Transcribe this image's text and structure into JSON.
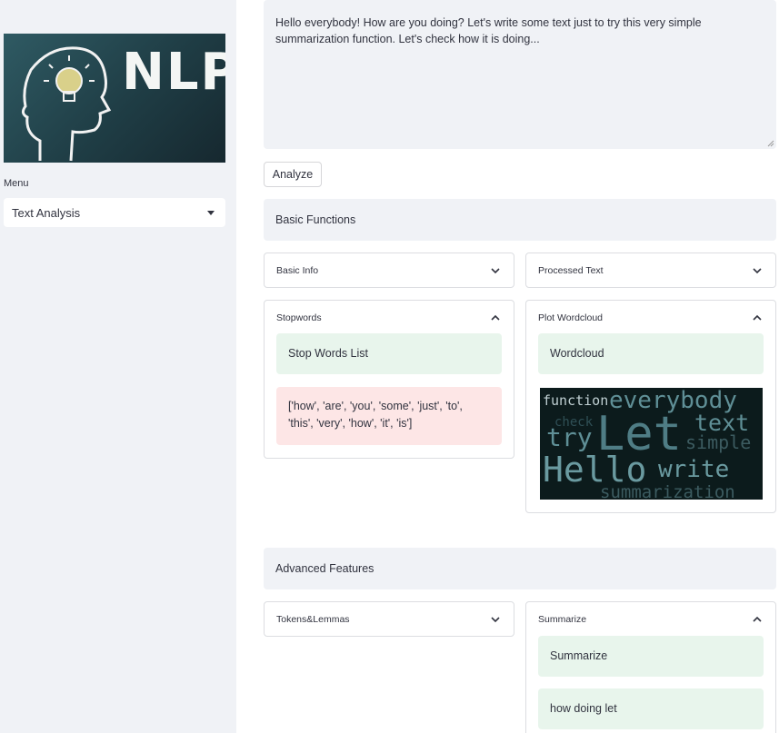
{
  "sidebar": {
    "logo_text": "NLP",
    "menu_label": "Menu",
    "menu_value": "Text Analysis"
  },
  "main": {
    "text_value": "Hello everybody! How are you doing? Let's write some text just to try this very simple summarization function. Let's check how it is doing...",
    "analyze_label": "Analyze",
    "basic_section": "Basic Functions",
    "advanced_section": "Advanced Features",
    "expanders": {
      "basic_info": "Basic Info",
      "processed_text": "Processed Text",
      "stopwords": "Stopwords",
      "plot_wordcloud": "Plot Wordcloud",
      "tokens_lemmas": "Tokens&Lemmas",
      "summarize": "Summarize"
    },
    "stopwords_title": "Stop Words List",
    "stopwords_list": "['how', 'are', 'you', 'some', 'just', 'to', 'this', 'very', 'how', 'it', 'is']",
    "wordcloud_title": "Wordcloud",
    "wordcloud_words": {
      "w_function": "function",
      "w_everybody": "everybody",
      "w_check": "check",
      "w_let": "Let",
      "w_text": "text",
      "w_try": "try",
      "w_simple": "simple",
      "w_hello": "Hello",
      "w_write": "write",
      "w_summarization": "summarization"
    },
    "summarize_title": "Summarize",
    "summary_result": "how doing let"
  },
  "colors": {
    "sidebar_bg": "#f0f2f6",
    "success_bg": "#e8f5ec",
    "error_bg": "#fde6e6",
    "wordcloud_bg": "#0c1b1c"
  }
}
